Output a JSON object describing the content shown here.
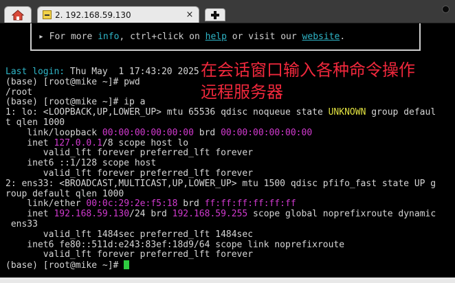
{
  "tabs": {
    "session_title": "2. 192.168.59.130",
    "close_glyph": "×",
    "new_tab_glyph": "+"
  },
  "banner": {
    "bullet": "▸",
    "pre": "For more ",
    "info": "info",
    "mid1": ", ctrl+click on ",
    "help": "help",
    "mid2": " or visit our ",
    "website": "website",
    "post": "."
  },
  "terminal": {
    "l0a": "Last login:",
    "l0b": " Thu May  1 17:43:20 2025",
    "l1": "(base) [root@mike ~]# pwd",
    "l2": "/root",
    "l3": "(base) [root@mike ~]# ip a",
    "l4a": "1: lo: <LOOPBACK,UP,LOWER_UP> mtu 65536 qdisc noqueue state ",
    "l4b": "UNKNOWN",
    "l4c": " group defaul",
    "l5": "t qlen 1000",
    "l6a": "    link/loopback ",
    "l6b": "00:00:00:00:00:00",
    "l6c": " brd ",
    "l6d": "00:00:00:00:00:00",
    "l7a": "    inet ",
    "l7b": "127.0.0.1",
    "l7c": "/8 scope host lo",
    "l8": "       valid_lft forever preferred_lft forever",
    "l9": "    inet6 ::1/128 scope host",
    "l10": "       valid_lft forever preferred_lft forever",
    "l11": "2: ens33: <BROADCAST,MULTICAST,UP,LOWER_UP> mtu 1500 qdisc pfifo_fast state UP g",
    "l12": "roup default qlen 1000",
    "l13a": "    link/ether ",
    "l13b": "00:0c:29:2e:f5:18",
    "l13c": " brd ",
    "l13d": "ff:ff:ff:ff:ff:ff",
    "l14a": "    inet ",
    "l14b": "192.168.59.130",
    "l14c": "/24 brd ",
    "l14d": "192.168.59.255",
    "l14e": " scope global noprefixroute dynamic",
    "l15": " ens33",
    "l16": "       valid_lft 1484sec preferred_lft 1484sec",
    "l17": "    inet6 fe80::511d:e243:83ef:18d9/64 scope link noprefixroute",
    "l18": "       valid_lft forever preferred_lft forever",
    "l19": "(base) [root@mike ~]# "
  },
  "annotation": {
    "line1": "在会话窗口输入各种命令操作",
    "line2": "远程服务器"
  },
  "colors": {
    "cyan": "#2fb6c8",
    "magenta": "#d23ad0",
    "yellow": "#e2e240",
    "annotation_red": "#f0283c",
    "cursor_green": "#2ecc40"
  }
}
